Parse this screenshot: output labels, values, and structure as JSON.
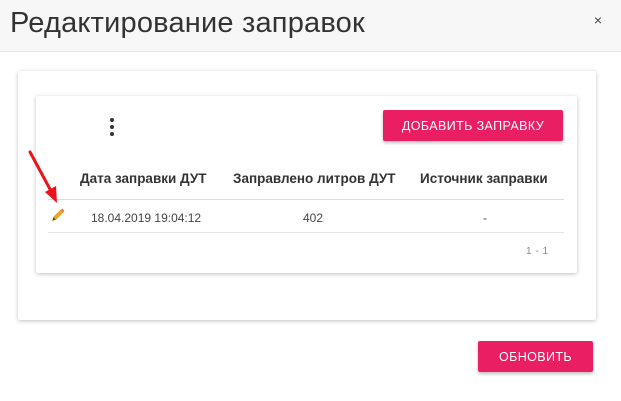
{
  "dialog": {
    "title": "Редактирование заправок",
    "close_glyph": "×",
    "refresh_label": "ОБНОВИТЬ"
  },
  "table": {
    "add_button_label": "ДОБАВИТЬ ЗАПРАВКУ",
    "columns": [
      "Дата заправки ДУТ",
      "Заправлено литров ДУТ",
      "Источник заправки"
    ],
    "rows": [
      {
        "date": "18.04.2019 19:04:12",
        "liters": "402",
        "source": "-"
      }
    ],
    "pagination": "1 - 1"
  },
  "icons": {
    "menu": "more-vert-icon",
    "edit": "pencil-icon",
    "annotation": "red-arrow"
  },
  "colors": {
    "accent": "#e91e63",
    "pencil": "#f5a623",
    "annotation_arrow": "#e8141b"
  }
}
